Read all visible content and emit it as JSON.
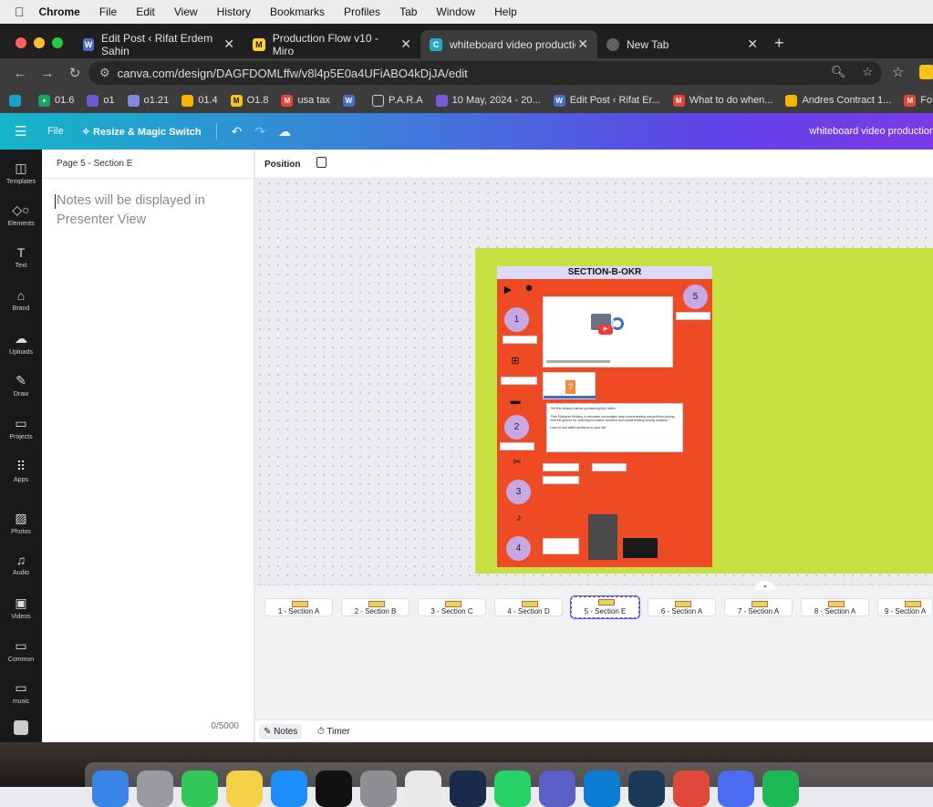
{
  "menubar": {
    "app": "Chrome",
    "items": [
      "File",
      "Edit",
      "View",
      "History",
      "Bookmarks",
      "Profiles",
      "Tab",
      "Window",
      "Help"
    ]
  },
  "tabs": [
    {
      "title": "Edit Post ‹ Rifat Erdem Sahin",
      "icon": "wordpress-icon",
      "color": "#4b6cc8"
    },
    {
      "title": "Production Flow v10 - Miro",
      "icon": "miro-icon",
      "color": "#ffd02f"
    },
    {
      "title": "whiteboard video production",
      "icon": "canva-icon",
      "color": "#2aa6c9",
      "active": true
    },
    {
      "title": "New Tab",
      "icon": "chrome-icon",
      "color": "#5f6368"
    }
  ],
  "address": {
    "url": "canva.com/design/DAGFDOMLffw/v8l4p5E0a4UFiABO4kDjJA/edit"
  },
  "bookmarks": [
    {
      "label": "",
      "color": "#1aa3c4"
    },
    {
      "label": "01.6",
      "color": "#1aa260"
    },
    {
      "label": "o1",
      "color": "#6a5acd"
    },
    {
      "label": "o1.21",
      "color": "#7e8bd8"
    },
    {
      "label": "01.4",
      "color": "#f4b400"
    },
    {
      "label": "O1.8",
      "color": "#f6c416"
    },
    {
      "label": "usa tax",
      "color": "#ea4335"
    },
    {
      "label": "",
      "color": "#4b6cc8"
    },
    {
      "label": "P.A.R.A",
      "color": "#555"
    },
    {
      "label": "10 May, 2024 - 20...",
      "color": "#7b5cd6"
    },
    {
      "label": "Edit Post ‹ Rifat Er...",
      "color": "#4b6cc8"
    },
    {
      "label": "What to do when...",
      "color": "#ea4335"
    },
    {
      "label": "Andres Contract 1...",
      "color": "#f4b400"
    },
    {
      "label": "Follow Up From C",
      "color": "#ea4335"
    }
  ],
  "canva_header": {
    "file": "File",
    "resize": "Resize & Magic Switch",
    "doc_title": "whiteboard video production"
  },
  "rail": [
    "Templates",
    "Elements",
    "Text",
    "Brand",
    "Uploads",
    "Draw",
    "Projects",
    "Apps",
    "Photos",
    "Audio",
    "Videos",
    "Common",
    "music"
  ],
  "notes": {
    "page_label": "Page 5 - Section E",
    "placeholder": "Notes will be displayed in Presenter View",
    "count": "0/5000"
  },
  "position_label": "Position",
  "board": {
    "title": "SECTION-B-OKR",
    "numbers": [
      "1",
      "2",
      "3",
      "4",
      "5"
    ],
    "quote": "The firts thinkers started questioning they selfes\n\n\"First Principles thinking in education encourages deep understanding and problem-solving from the ground up, fostering innovative solutions and critical thinking among students.\"\n\nLearn to ask better questions to your self"
  },
  "pages": [
    "1 - Section A",
    "2 - Section B",
    "3 - Section C",
    "4 - Section D",
    "5 - Section E",
    "6 - Section A",
    "7 - Section A",
    "8 - Section A",
    "9 - Section A"
  ],
  "selected_page": 4,
  "bottom": {
    "notes": "Notes",
    "timer": "Timer"
  }
}
